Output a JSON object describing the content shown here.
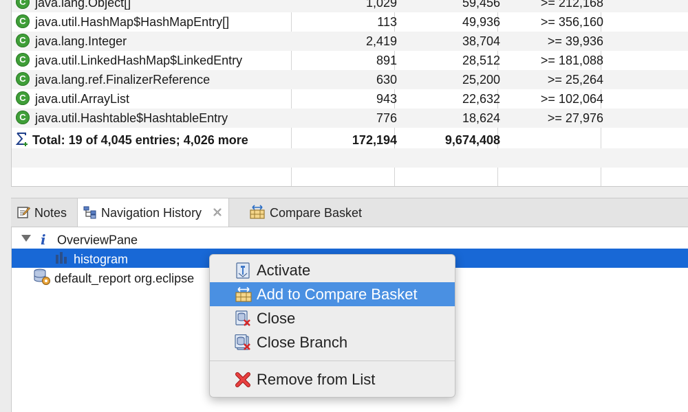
{
  "histogram": {
    "rows": [
      {
        "name": "java.lang.Object[]",
        "objects": "1,029",
        "shallow": "59,456",
        "retained": ">= 212,168"
      },
      {
        "name": "java.util.HashMap$HashMapEntry[]",
        "objects": "113",
        "shallow": "49,936",
        "retained": ">= 356,160"
      },
      {
        "name": "java.lang.Integer",
        "objects": "2,419",
        "shallow": "38,704",
        "retained": ">= 39,936"
      },
      {
        "name": "java.util.LinkedHashMap$LinkedEntry",
        "objects": "891",
        "shallow": "28,512",
        "retained": ">= 181,088"
      },
      {
        "name": "java.lang.ref.FinalizerReference",
        "objects": "630",
        "shallow": "25,200",
        "retained": ">= 25,264"
      },
      {
        "name": "java.util.ArrayList",
        "objects": "943",
        "shallow": "22,632",
        "retained": ">= 102,064"
      },
      {
        "name": "java.util.Hashtable$HashtableEntry",
        "objects": "776",
        "shallow": "18,624",
        "retained": ">= 27,976"
      }
    ],
    "class_icon_letter": "C",
    "total": {
      "label": "Total: 19 of 4,045 entries; 4,026 more",
      "objects": "172,194",
      "shallow": "9,674,408"
    }
  },
  "tabs": [
    {
      "label": "Notes",
      "icon": "notes-icon"
    },
    {
      "label": "Navigation History",
      "icon": "navigation-history-icon",
      "active": true
    },
    {
      "label": "Compare Basket",
      "icon": "compare-basket-icon"
    }
  ],
  "tree": {
    "root": {
      "label": "OverviewPane",
      "icon": "info-icon",
      "info_glyph": "i"
    },
    "child": {
      "label": "histogram",
      "icon": "histogram-icon"
    },
    "report": {
      "label": "default_report  org.eclipse",
      "icon": "report-icon"
    }
  },
  "context_menu": {
    "items": [
      {
        "label": "Activate",
        "icon": "activate-icon"
      },
      {
        "label": "Add to Compare Basket",
        "icon": "compare-basket-icon"
      },
      {
        "label": "Close",
        "icon": "close-icon"
      },
      {
        "label": "Close Branch",
        "icon": "close-branch-icon"
      },
      {
        "label": "Remove from List",
        "icon": "remove-icon"
      }
    ]
  },
  "colors": {
    "selection": "#1868d6",
    "menu_highlight": "#4a90e2",
    "class_icon": "#3f9e38"
  }
}
